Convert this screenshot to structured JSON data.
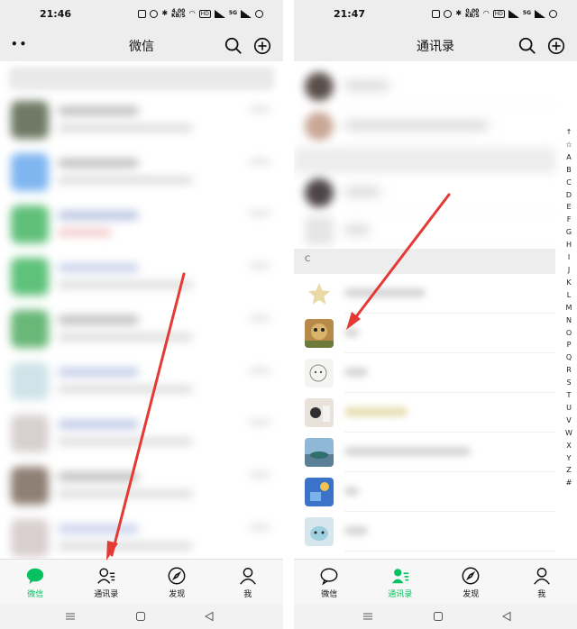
{
  "left": {
    "status_time": "21:46",
    "net_speed_top": "4.00",
    "net_speed_unit": "KB/S",
    "title": "微信",
    "active_tab": 0
  },
  "right": {
    "status_time": "21:47",
    "net_speed_top": "0.00",
    "net_speed_unit": "KB/S",
    "title": "通讯录",
    "section_label": "C",
    "index_letters": [
      "↑",
      "☆",
      "A",
      "B",
      "C",
      "D",
      "E",
      "F",
      "G",
      "H",
      "I",
      "J",
      "K",
      "L",
      "M",
      "N",
      "O",
      "P",
      "Q",
      "R",
      "S",
      "T",
      "U",
      "V",
      "W",
      "X",
      "Y",
      "Z",
      "#"
    ],
    "active_tab": 1
  },
  "status_labels": {
    "hd": "HD",
    "sim": "5G"
  },
  "tabs": [
    {
      "label": "微信",
      "icon": "chat-bubble-icon"
    },
    {
      "label": "通讯录",
      "icon": "contacts-icon"
    },
    {
      "label": "发现",
      "icon": "compass-icon"
    },
    {
      "label": "我",
      "icon": "person-icon"
    }
  ],
  "colors": {
    "accent": "#07c160",
    "arrow": "#e53935",
    "header_bg": "#ededed"
  }
}
